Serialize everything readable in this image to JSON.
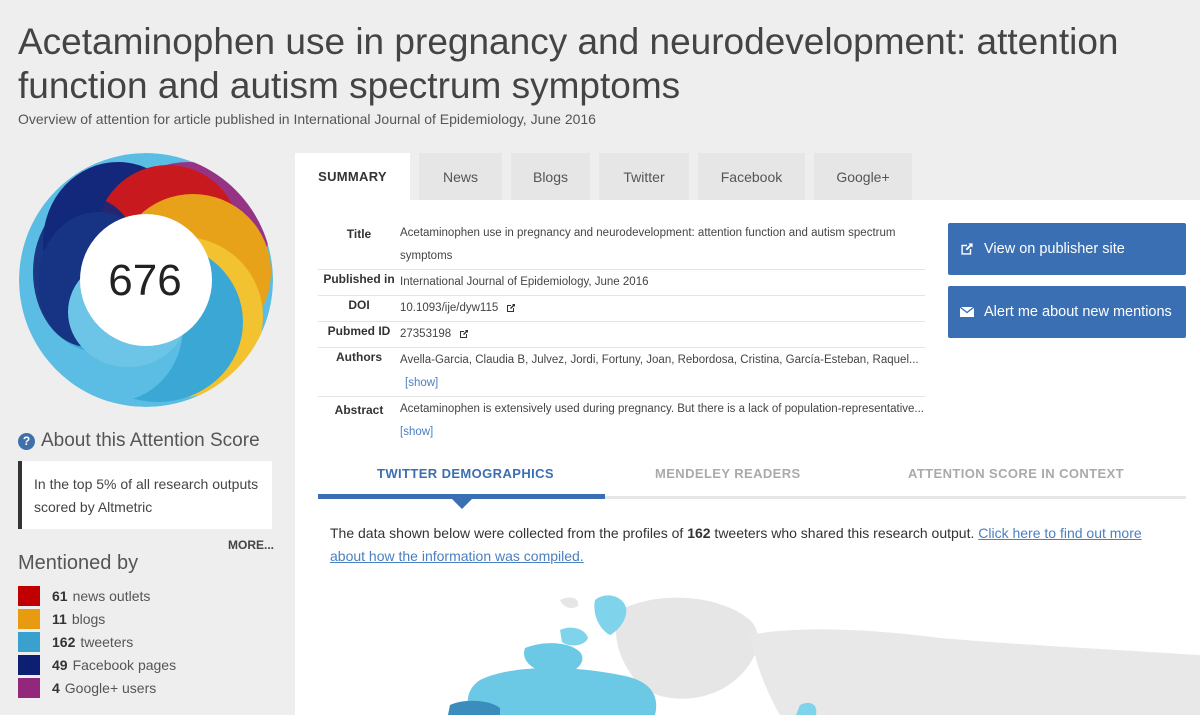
{
  "header": {
    "title": "Acetaminophen use in pregnancy and neurodevelopment: attention function and autism spectrum symptoms",
    "subtitle": "Overview of attention for article published in International Journal of Epidemiology, June 2016"
  },
  "score": {
    "value": "676",
    "colors": [
      "#c8191e",
      "#e8a21a",
      "#3aa7d4",
      "#13287a",
      "#9b2b7e"
    ]
  },
  "about": {
    "title": "About this Attention Score",
    "icon": "question-circle-icon",
    "text": "In the top 5% of all research outputs scored by Altmetric",
    "more": "MORE..."
  },
  "mentioned": {
    "title": "Mentioned by",
    "items": [
      {
        "count": "61",
        "label": "news outlets",
        "color": "#c00000"
      },
      {
        "count": "11",
        "label": "blogs",
        "color": "#e89b10"
      },
      {
        "count": "162",
        "label": "tweeters",
        "color": "#3aa1cf"
      },
      {
        "count": "49",
        "label": "Facebook pages",
        "color": "#0d1f73"
      },
      {
        "count": "4",
        "label": "Google+ users",
        "color": "#92277b"
      }
    ]
  },
  "tabs": [
    "SUMMARY",
    "News",
    "Blogs",
    "Twitter",
    "Facebook",
    "Google+"
  ],
  "meta": {
    "title_label": "Title",
    "title_value": "Acetaminophen use in pregnancy and neurodevelopment: attention function and autism spectrum symptoms",
    "published_label": "Published in",
    "published_value": "International Journal of Epidemiology, June 2016",
    "doi_label": "DOI",
    "doi_value": "10.1093/ije/dyw115",
    "pubmed_label": "Pubmed ID",
    "pubmed_value": "27353198",
    "authors_label": "Authors",
    "authors_value": "Avella-Garcia, Claudia B, Julvez, Jordi, Fortuny, Joan, Rebordosa, Cristina, García-Esteban, Raquel...",
    "authors_show": "[show]",
    "abstract_label": "Abstract",
    "abstract_value": "Acetaminophen is extensively used during pregnancy. But there is a lack of population-representative...",
    "abstract_show": "[show]"
  },
  "buttons": {
    "publisher": "View on publisher site",
    "alert": "Alert me about new mentions"
  },
  "subtabs": [
    "TWITTER DEMOGRAPHICS",
    "MENDELEY READERS",
    "ATTENTION SCORE IN CONTEXT"
  ],
  "demographics": {
    "text_before": "The data shown below were collected from the profiles of ",
    "count": "162",
    "text_after": " tweeters who shared this research output. ",
    "link": "Click here to find out more about how the information was compiled."
  }
}
